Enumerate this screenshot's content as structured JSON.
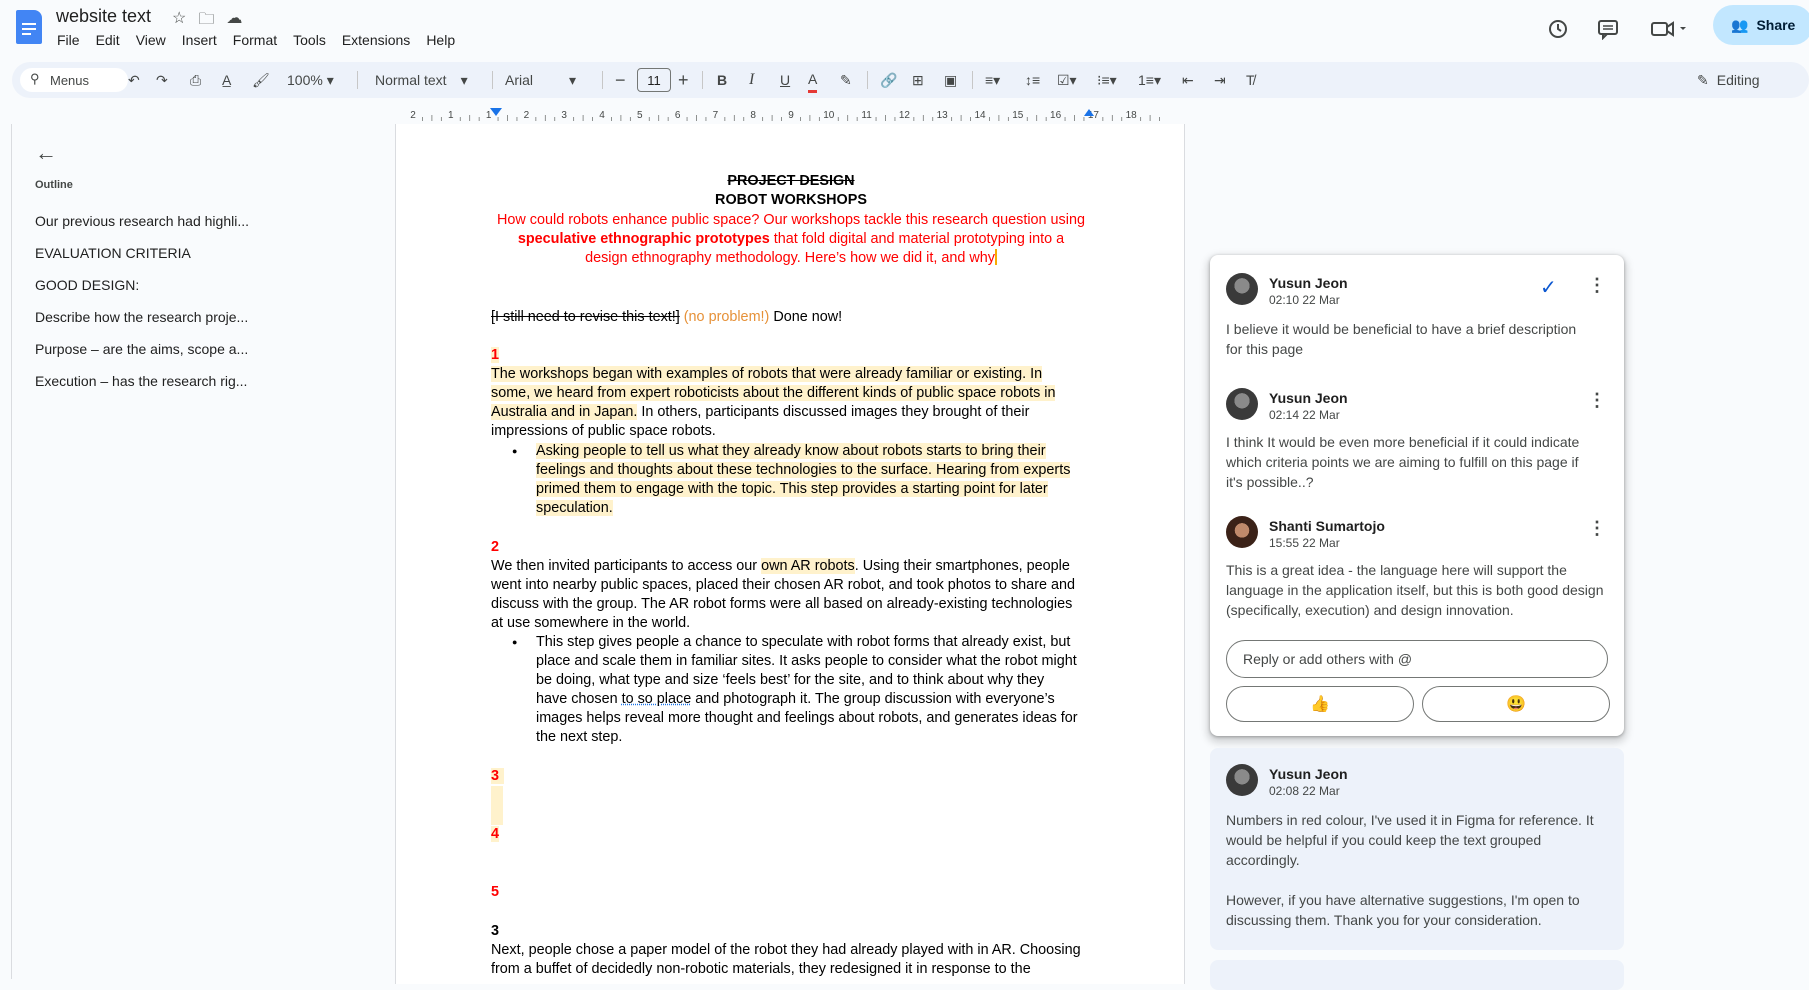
{
  "app": {
    "doc_title": "website text",
    "menus": [
      "File",
      "Edit",
      "View",
      "Insert",
      "Format",
      "Tools",
      "Extensions",
      "Help"
    ],
    "share_label": "Share",
    "editing_label": "Editing"
  },
  "toolbar": {
    "menus_label": "Menus",
    "zoom": "100%",
    "style": "Normal text",
    "font": "Arial",
    "font_size": "11"
  },
  "ruler": {
    "marks": [
      "2",
      "1",
      "1",
      "2",
      "3",
      "4",
      "5",
      "6",
      "7",
      "8",
      "9",
      "10",
      "11",
      "12",
      "13",
      "14",
      "15",
      "16",
      "17",
      "18"
    ]
  },
  "outline": {
    "heading": "Outline",
    "items": [
      "Our previous research had highli...",
      "EVALUATION CRITERIA",
      "GOOD DESIGN:",
      "Describe how the research proje...",
      "Purpose – are the aims, scope a...",
      "Execution – has the research rig..."
    ]
  },
  "document": {
    "title_struck": "PROJECT DESIGN",
    "title": "ROBOT WORKSHOPS",
    "intro_1": "How could robots enhance public space? Our workshops tackle this research question using",
    "intro_2_bold": "speculative ethnographic prototypes",
    "intro_2_rest": " that fold digital and material prototyping into a",
    "intro_3": "design ethnography methodology. Here’s how we did it, and why",
    "note_struck": "[I still need to revise this text!]",
    "note_orange": "(no problem!)",
    "note_done": "Done now!",
    "num1": "1",
    "p1_l1": "The workshops began with examples of robots that were already familiar or existing. In",
    "p1_l2": "some, we heard from expert roboticists about the different kinds of public space robots in",
    "p1_l3_hl": "Australia and in Japan.",
    "p1_l3_rest": " In others, participants discussed images they brought of their",
    "p1_l4": "impressions of public space robots.",
    "b1_l1": "Asking people to tell us what they already know about robots starts to bring their",
    "b1_l2": "feelings and thoughts about these technologies to the surface. Hearing from experts",
    "b1_l3": "primed them to engage with the topic. This step provides a starting point for later",
    "b1_l4": "speculation.",
    "num2": "2",
    "p2_l1_a": "We then invited participants to access our ",
    "p2_l1_hl": "own AR robots",
    "p2_l1_b": ". Using their smartphones, people",
    "p2_l2": "went into nearby public spaces, placed their chosen AR robot, and took photos to share and",
    "p2_l3": "discuss with the group. The AR robot forms were all based on already-existing technologies",
    "p2_l4": "at use somewhere in the world.",
    "b2_l1": "This step gives people a chance to speculate with robot forms that already exist, but",
    "b2_l2": "place and scale them in familiar sites. It asks people to consider what the robot might",
    "b2_l3": "be doing, what type and size ‘feels best’ for the site, and to think about why they",
    "b2_l4a": "have chosen ",
    "b2_l4u": "to so place",
    "b2_l4b": " and photograph it. The group discussion with everyone’s",
    "b2_l5": "images helps reveal more thought and feelings about robots, and generates ideas for",
    "b2_l6": "the next step.",
    "num3": "3",
    "num4": "4",
    "num5": "5",
    "num3b": "3",
    "p3_l1": "Next, people chose a paper model of the robot they had already played with in AR. Choosing",
    "p3_l2": "from a buffet of decidedly non-robotic materials, they redesigned it in response to the"
  },
  "comments": {
    "thread1": [
      {
        "name": "Yusun Jeon",
        "time": "02:10 22 Mar",
        "text": "I believe it would be beneficial to have a brief description for this page"
      },
      {
        "name": "Yusun Jeon",
        "time": "02:14 22 Mar",
        "text": "I think It would be even more beneficial if it could indicate which criteria points we are aiming to fulfill on this page if it's possible..?"
      },
      {
        "name": "Shanti Sumartojo",
        "time": "15:55 22 Mar",
        "text": "This is a great idea - the language here will support the language in the application itself, but this is both good design (specifically, execution) and design innovation."
      }
    ],
    "reply_placeholder": "Reply or add others with @",
    "emoji_1": "👍",
    "emoji_2": "😃",
    "thread2": {
      "name": "Yusun Jeon",
      "time": "02:08 22 Mar",
      "text_1": "Numbers in red colour, I've used it in Figma for reference. It would be helpful if you could keep the text grouped accordingly.",
      "text_2": "However, if you have alternative suggestions, I'm open to discussing them. Thank you for your consideration."
    }
  }
}
